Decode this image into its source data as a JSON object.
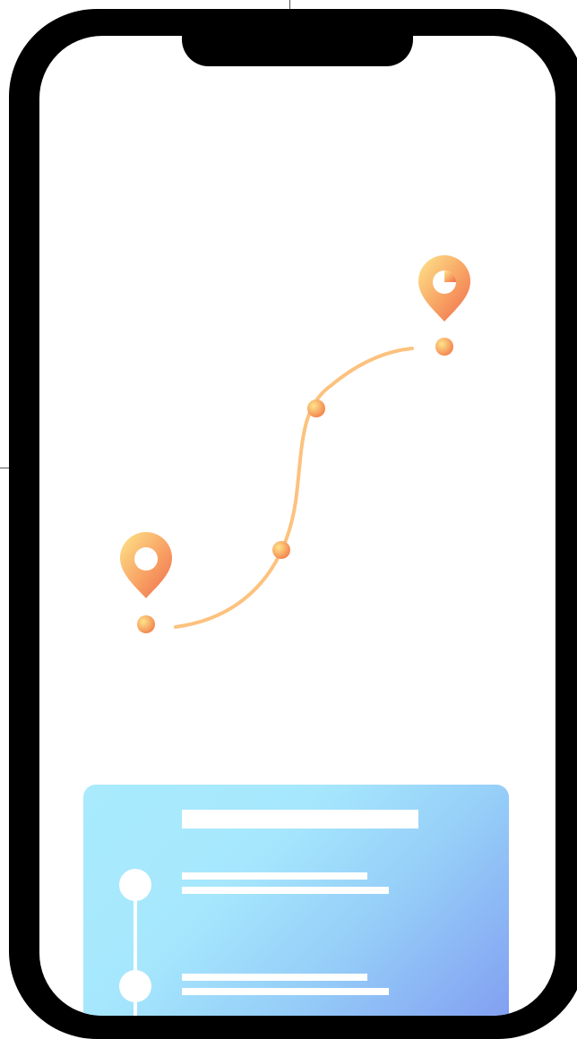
{
  "screen": {
    "type": "route-tracking illustration",
    "colors": {
      "frame": "#000000",
      "screen": "#ffffff",
      "route_path": "#fcc27e",
      "pin_light": "#fde58a",
      "pin_dark": "#ef6b4c",
      "card_light": "#a9ebfd",
      "card_dark": "#7f98f0"
    }
  },
  "map": {
    "start_pin_icon": "map-pin-start-icon",
    "end_pin_icon": "map-pin-end-icon",
    "waypoint_count": 4
  },
  "timeline_card": {
    "placeholder_title": true,
    "entries": [
      {
        "icon": "timeline-node-icon",
        "text_lines": 2
      },
      {
        "icon": "timeline-node-icon",
        "text_lines": 2
      }
    ]
  }
}
